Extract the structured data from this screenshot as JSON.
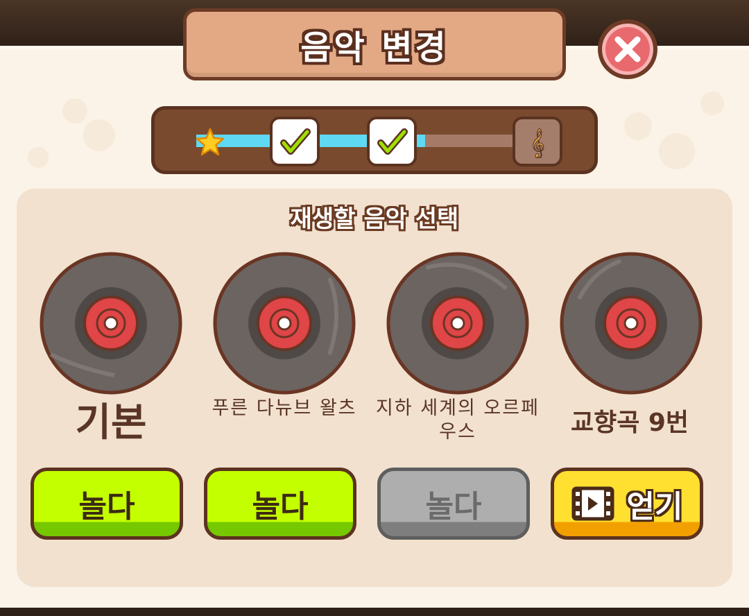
{
  "dialog": {
    "title": "음악 변경",
    "close_icon": "close-x-icon"
  },
  "progress": {
    "fill_fraction": 0.66,
    "nodes": [
      {
        "icon": "star-icon",
        "state": "done"
      },
      {
        "icon": "checkmark-icon",
        "state": "done"
      },
      {
        "icon": "checkmark-icon",
        "state": "done"
      },
      {
        "icon": "treble-clef-icon",
        "state": "locked"
      }
    ]
  },
  "selection": {
    "title": "재생할 음악 선택",
    "tracks": [
      {
        "name": "기본",
        "button_label": "놀다",
        "button_state": "available"
      },
      {
        "name": "푸른 다뉴브 왈츠",
        "button_label": "놀다",
        "button_state": "available"
      },
      {
        "name": "지하 세계의 오르페우스",
        "button_label": "놀다",
        "button_state": "disabled"
      },
      {
        "name": "교향곡 9번",
        "button_label": "얻기",
        "button_state": "watch-video",
        "button_icon": "film-video-icon"
      }
    ]
  },
  "colors": {
    "panel": "#fbf3e7",
    "accent_brown": "#6d3b26",
    "play_green": "#c4ff00",
    "get_gold": "#ffe030",
    "progress_blue": "#5fd8f3"
  }
}
